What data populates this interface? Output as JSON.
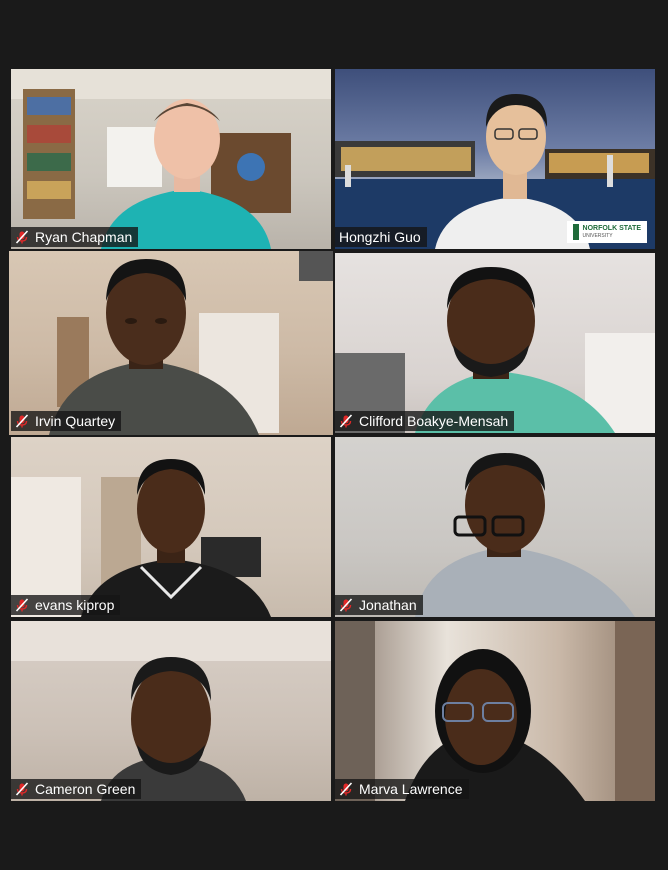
{
  "participants": [
    {
      "name": "Ryan Chapman"
    },
    {
      "name": "Hongzhi Guo",
      "background_logo": "NORFOLK STATE",
      "background_logo_sub": "UNIVERSITY"
    },
    {
      "name": "Irvin Quartey",
      "active_speaker": true
    },
    {
      "name": "Clifford Boakye-Mensah"
    },
    {
      "name": "evans kiprop"
    },
    {
      "name": "Jonathan"
    },
    {
      "name": "Cameron Green"
    },
    {
      "name": "Marva Lawrence"
    }
  ],
  "icons": {
    "muted": "mic-muted-icon"
  },
  "colors": {
    "active_border": "#e3e85a",
    "muted_icon": "#e02828",
    "background": "#1a1a1a"
  }
}
